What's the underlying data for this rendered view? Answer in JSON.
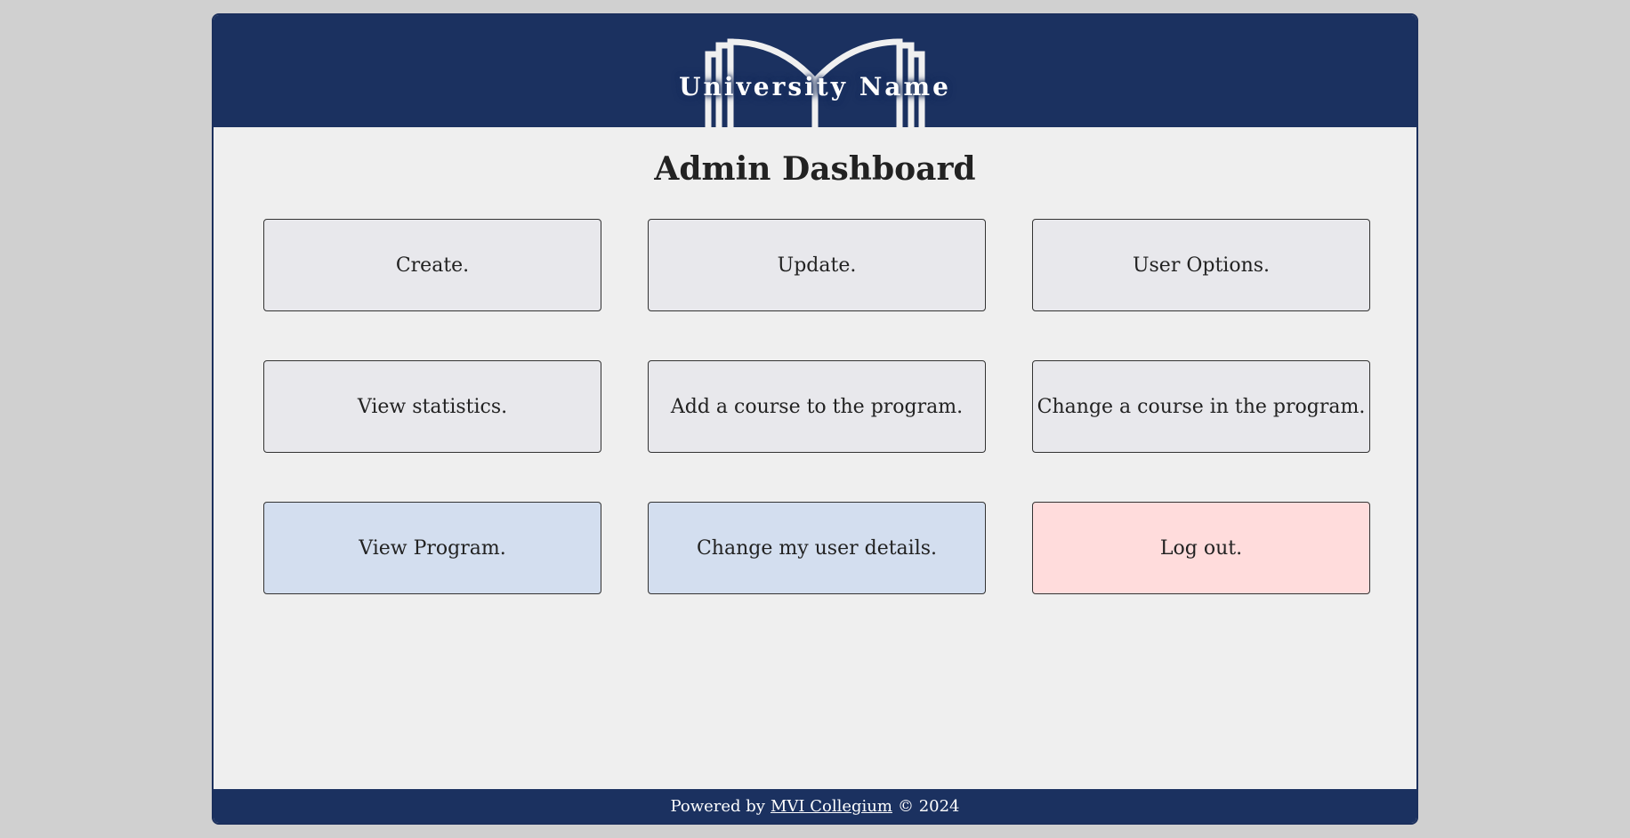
{
  "header": {
    "logo_text": "University Name"
  },
  "main": {
    "title": "Admin Dashboard",
    "tiles": [
      {
        "label": "Create."
      },
      {
        "label": "Update."
      },
      {
        "label": "User Options."
      },
      {
        "label": "View statistics."
      },
      {
        "label": "Add a course to the program."
      },
      {
        "label": "Change a course in the program."
      },
      {
        "label": "View Program."
      },
      {
        "label": "Change my user details."
      },
      {
        "label": "Log out."
      }
    ]
  },
  "footer": {
    "prefix": "Powered by",
    "link_text": "MVI Collegium",
    "suffix": "© 2024"
  },
  "colors": {
    "brand_navy": "#1b3160",
    "page_bg": "#efefef",
    "tile_default": "#e8e8ec",
    "tile_blue": "#d3deef",
    "tile_red": "#ffdcdc"
  }
}
